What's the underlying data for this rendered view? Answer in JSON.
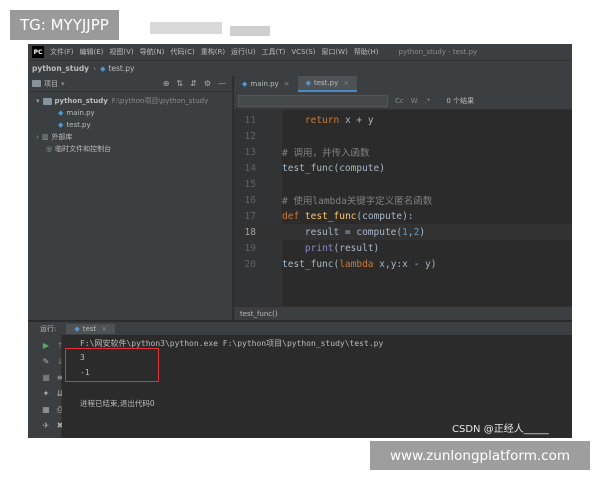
{
  "watermark_top": "TG: MYYJJPP",
  "watermark_bottom": "www.zunlongplatform.com",
  "credit": "CSDN @正经人_____",
  "menubar": {
    "logo": "PC",
    "items": [
      "文件(F)",
      "编辑(E)",
      "视图(V)",
      "导航(N)",
      "代码(C)",
      "重构(R)",
      "运行(U)",
      "工具(T)",
      "VCS(S)",
      "窗口(W)",
      "帮助(H)"
    ],
    "window_title": "python_study - test.py"
  },
  "navbar": {
    "project": "python_study",
    "file": "test.py"
  },
  "project_panel": {
    "header": "项目",
    "tree": [
      {
        "label": "python_study",
        "sub": "F:\\python项目\\python_study",
        "kind": "folder"
      },
      {
        "label": "main.py",
        "kind": "py"
      },
      {
        "label": "test.py",
        "kind": "py"
      },
      {
        "label": "外部库",
        "kind": "lib"
      },
      {
        "label": "临时文件和控制台",
        "kind": "scratch"
      }
    ]
  },
  "editor": {
    "tabs": [
      {
        "label": "main.py",
        "active": false
      },
      {
        "label": "test.py",
        "active": true
      }
    ],
    "find_options": [
      "Cc",
      "W",
      ".*"
    ],
    "find_results": "0 个结果",
    "current_line": 18,
    "lines": [
      {
        "n": "11",
        "indent": "    ",
        "parts": [
          {
            "t": "return",
            "c": "kw"
          },
          {
            "t": " x + y",
            "c": ""
          }
        ]
      },
      {
        "n": "12",
        "indent": "",
        "parts": []
      },
      {
        "n": "13",
        "indent": "",
        "parts": [
          {
            "t": "# 调用，并传入函数",
            "c": "cm"
          }
        ]
      },
      {
        "n": "14",
        "indent": "",
        "parts": [
          {
            "t": "test_func(compute)",
            "c": ""
          }
        ]
      },
      {
        "n": "15",
        "indent": "",
        "parts": []
      },
      {
        "n": "16",
        "indent": "",
        "parts": [
          {
            "t": "# 使用lambda关键字定义匿名函数",
            "c": "cm"
          }
        ]
      },
      {
        "n": "17",
        "indent": "",
        "parts": [
          {
            "t": "def",
            "c": "kw"
          },
          {
            "t": " ",
            "c": ""
          },
          {
            "t": "test_func",
            "c": "fn"
          },
          {
            "t": "(compute):",
            "c": ""
          }
        ]
      },
      {
        "n": "18",
        "indent": "    ",
        "parts": [
          {
            "t": "result = compute(",
            "c": ""
          },
          {
            "t": "1",
            "c": "num"
          },
          {
            "t": ",",
            "c": ""
          },
          {
            "t": "2",
            "c": "num"
          },
          {
            "t": ")",
            "c": ""
          }
        ]
      },
      {
        "n": "19",
        "indent": "    ",
        "parts": [
          {
            "t": "print",
            "c": "bi"
          },
          {
            "t": "(result)",
            "c": ""
          }
        ]
      },
      {
        "n": "20",
        "indent": "",
        "parts": [
          {
            "t": "test_func(",
            "c": ""
          },
          {
            "t": "lambda",
            "c": "lam"
          },
          {
            "t": " x,y:x - y)",
            "c": ""
          }
        ]
      }
    ],
    "breadcrumb": "test_func()"
  },
  "run": {
    "label": "运行:",
    "tab": "test",
    "console": [
      "F:\\网安软件\\python3\\python.exe F:\\python项目\\python_study\\test.py",
      "3",
      "-1",
      "",
      "进程已结束,退出代码0"
    ]
  }
}
